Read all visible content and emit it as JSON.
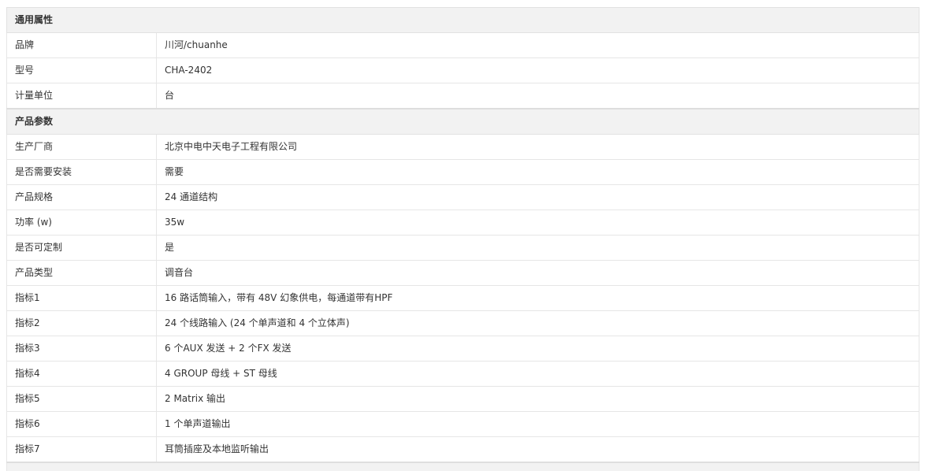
{
  "sections": [
    {
      "title": "通用属性",
      "rows": [
        {
          "name": "品牌",
          "value": "川河/chuanhe"
        },
        {
          "name": "型号",
          "value": "CHA-2402"
        },
        {
          "name": "计量单位",
          "value": "台"
        }
      ]
    },
    {
      "title": "产品参数",
      "rows": [
        {
          "name": "生产厂商",
          "value": "北京中电中天电子工程有限公司"
        },
        {
          "name": "是否需要安装",
          "value": "需要"
        },
        {
          "name": "产品规格",
          "value": "24 通道结构"
        },
        {
          "name": "功率 (w)",
          "value": "35w"
        },
        {
          "name": "是否可定制",
          "value": "是"
        },
        {
          "name": "产品类型",
          "value": "调音台"
        },
        {
          "name": "指标1",
          "value": "16 路话筒输入，带有 48V 幻象供电，每通道带有HPF"
        },
        {
          "name": "指标2",
          "value": "24 个线路输入 (24 个单声道和 4 个立体声)"
        },
        {
          "name": "指标3",
          "value": "6 个AUX 发送 + 2 个FX 发送"
        },
        {
          "name": "指标4",
          "value": "4 GROUP 母线 + ST 母线"
        },
        {
          "name": "指标5",
          "value": "2 Matrix 输出"
        },
        {
          "name": "指标6",
          "value": "1 个单声道输出"
        },
        {
          "name": "指标7",
          "value": "耳筒插座及本地监听输出"
        }
      ]
    }
  ]
}
